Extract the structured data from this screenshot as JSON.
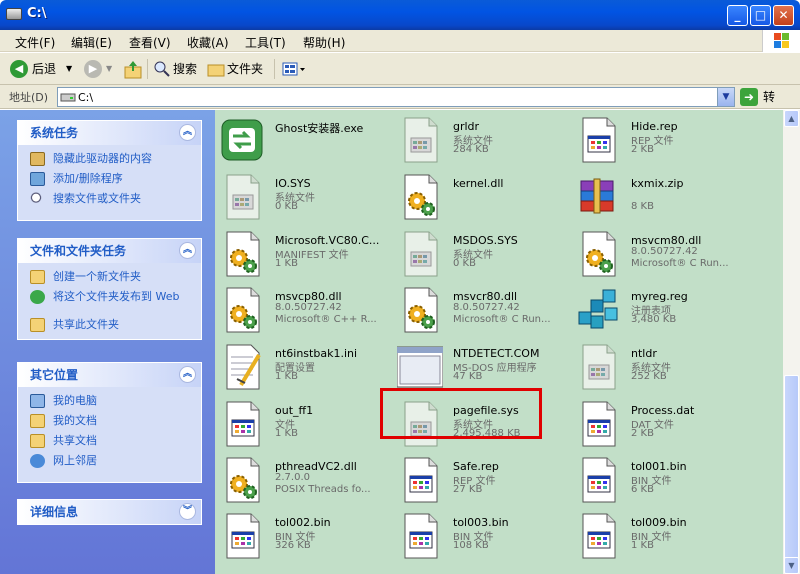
{
  "window": {
    "title": "C:\\"
  },
  "menu": [
    "文件(F)",
    "编辑(E)",
    "查看(V)",
    "收藏(A)",
    "工具(T)",
    "帮助(H)"
  ],
  "toolbar": {
    "back": "后退",
    "search": "搜索",
    "folders": "文件夹"
  },
  "address": {
    "label": "地址(D)",
    "value": "C:\\",
    "go": "转到"
  },
  "tasks": {
    "system": {
      "title": "系统任务",
      "items": [
        "隐藏此驱动器的内容",
        "添加/删除程序",
        "搜索文件或文件夹"
      ]
    },
    "file": {
      "title": "文件和文件夹任务",
      "items": [
        "创建一个新文件夹",
        "将这个文件夹发布到 Web",
        "共享此文件夹"
      ]
    },
    "other": {
      "title": "其它位置",
      "items": [
        "我的电脑",
        "我的文档",
        "共享文档",
        "网上邻居"
      ]
    },
    "details": {
      "title": "详细信息"
    }
  },
  "files": [
    {
      "name": "Ghost安装器.exe",
      "l2": "",
      "l3": "",
      "icon": "ghost-exe-icon"
    },
    {
      "name": "grldr",
      "l2": "系统文件",
      "l3": "284 KB",
      "icon": "system-file-icon"
    },
    {
      "name": "Hide.rep",
      "l2": "REP 文件",
      "l3": "2 KB",
      "icon": "generic-file-icon"
    },
    {
      "name": "IO.SYS",
      "l2": "系统文件",
      "l3": "0 KB",
      "icon": "system-file-icon"
    },
    {
      "name": "kernel.dll",
      "l2": "",
      "l3": "",
      "icon": "dll-file-icon"
    },
    {
      "name": "kxmix.zip",
      "l2": "",
      "l3": "8 KB",
      "icon": "winrar-archive-icon"
    },
    {
      "name": "Microsoft.VC80.C...",
      "l2": "MANIFEST 文件",
      "l3": "1 KB",
      "icon": "manifest-file-icon"
    },
    {
      "name": "MSDOS.SYS",
      "l2": "系统文件",
      "l3": "0 KB",
      "icon": "system-file-icon"
    },
    {
      "name": "msvcm80.dll",
      "l2": "8.0.50727.42",
      "l3": "Microsoft® C Run...",
      "icon": "dll-file-icon"
    },
    {
      "name": "msvcp80.dll",
      "l2": "8.0.50727.42",
      "l3": "Microsoft® C++ R...",
      "icon": "dll-file-icon"
    },
    {
      "name": "msvcr80.dll",
      "l2": "8.0.50727.42",
      "l3": "Microsoft® C Run...",
      "icon": "dll-file-icon"
    },
    {
      "name": "myreg.reg",
      "l2": "注册表项",
      "l3": "3,480 KB",
      "icon": "registry-file-icon"
    },
    {
      "name": "nt6instbak1.ini",
      "l2": "配置设置",
      "l3": "1 KB",
      "icon": "ini-file-icon"
    },
    {
      "name": "NTDETECT.COM",
      "l2": "MS-DOS 应用程序",
      "l3": "47 KB",
      "icon": "dos-app-icon"
    },
    {
      "name": "ntldr",
      "l2": "系统文件",
      "l3": "252 KB",
      "icon": "system-file-icon"
    },
    {
      "name": "out_ff1",
      "l2": "文件",
      "l3": "1 KB",
      "icon": "generic-file-icon"
    },
    {
      "name": "pagefile.sys",
      "l2": "系统文件",
      "l3": "2,495,488 KB",
      "icon": "system-file-icon"
    },
    {
      "name": "Process.dat",
      "l2": "DAT 文件",
      "l3": "2 KB",
      "icon": "generic-file-icon"
    },
    {
      "name": "pthreadVC2.dll",
      "l2": "2.7.0.0",
      "l3": "POSIX Threads fo...",
      "icon": "dll-file-icon"
    },
    {
      "name": "Safe.rep",
      "l2": "REP 文件",
      "l3": "27 KB",
      "icon": "generic-file-icon"
    },
    {
      "name": "tol001.bin",
      "l2": "BIN 文件",
      "l3": "6 KB",
      "icon": "generic-file-icon"
    },
    {
      "name": "tol002.bin",
      "l2": "BIN 文件",
      "l3": "326 KB",
      "icon": "generic-file-icon"
    },
    {
      "name": "tol003.bin",
      "l2": "BIN 文件",
      "l3": "108 KB",
      "icon": "generic-file-icon"
    },
    {
      "name": "tol009.bin",
      "l2": "BIN 文件",
      "l3": "1 KB",
      "icon": "generic-file-icon"
    }
  ]
}
